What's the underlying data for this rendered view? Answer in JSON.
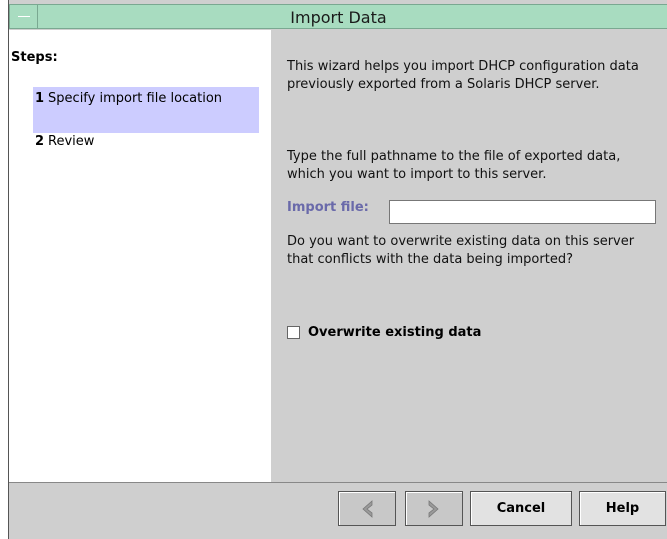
{
  "window": {
    "title": "Import Data"
  },
  "steps": {
    "heading": "Steps:",
    "items": [
      {
        "number": "1",
        "label": "Specify import file location",
        "active": true
      },
      {
        "number": "2",
        "label": "Review",
        "active": false
      }
    ]
  },
  "content": {
    "intro": "This wizard helps you import DHCP configuration data previously exported from a Solaris DHCP server.",
    "instruction": "Type the full pathname to the file of exported data, which you want to import to this server.",
    "import_file_label": "Import file:",
    "import_file_value": "",
    "overwrite_question": "Do you want to overwrite existing data on this server that conflicts with the data being imported?",
    "overwrite_checkbox_label": "Overwrite existing data",
    "overwrite_checked": false
  },
  "footer": {
    "back_icon": "back-arrow-icon",
    "next_icon": "next-arrow-icon",
    "cancel_label": "Cancel",
    "help_label": "Help"
  },
  "colors": {
    "titlebar": "#a8dcc0",
    "active_step": "#ccccff",
    "panel": "#cfcfcf",
    "label_accent": "#6a6aaa"
  }
}
